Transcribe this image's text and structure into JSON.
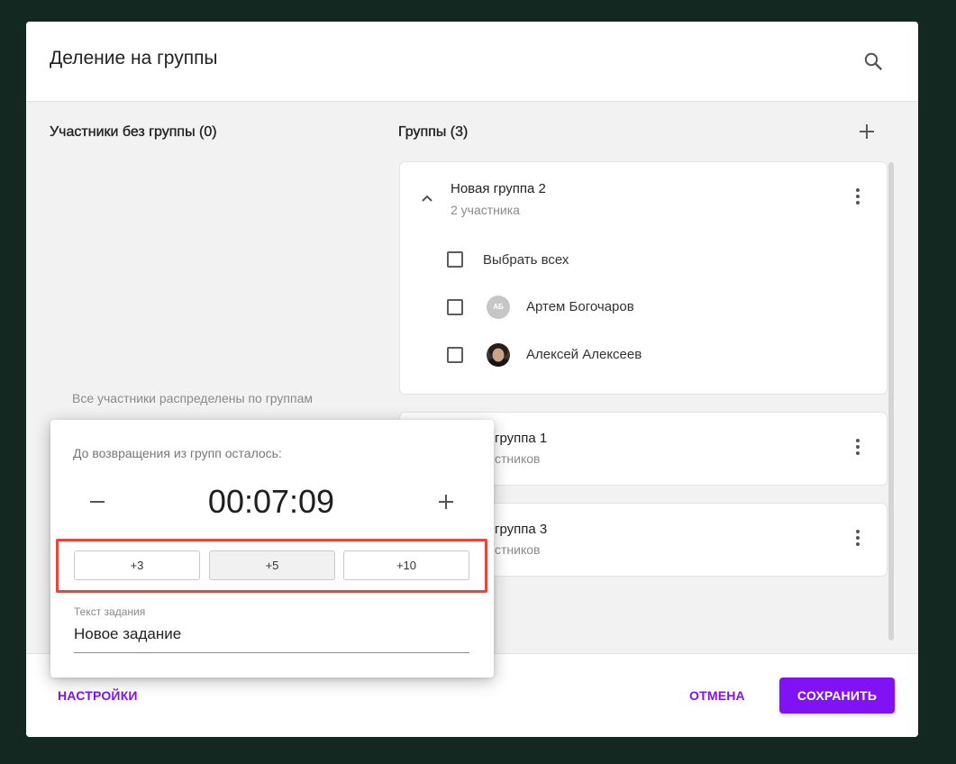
{
  "dialog": {
    "title": "Деление на группы"
  },
  "unassigned": {
    "heading": "Участники без группы (0)",
    "empty_text": "Все участники распределены по группам"
  },
  "groups": {
    "heading": "Группы (3)",
    "items": [
      {
        "title": "Новая группа 2",
        "subtitle": "2 участника",
        "expanded": true,
        "select_all_label": "Выбрать всех",
        "select_all_checked": false,
        "members": [
          {
            "name": "Артем Богочаров",
            "initials": "АБ",
            "checked": false
          },
          {
            "name": "Алексей Алексеев",
            "checked": false
          }
        ]
      },
      {
        "title": "группа 1",
        "subtitle": "стников",
        "expanded": false
      },
      {
        "title": "группа 3",
        "subtitle": "стников",
        "expanded": false
      }
    ]
  },
  "timer_popover": {
    "label": "До возвращения из групп осталось:",
    "time": "00:07:09",
    "quick_add": [
      "+3",
      "+5",
      "+10"
    ],
    "task_label": "Текст задания",
    "task_value": "Новое задание"
  },
  "footer": {
    "settings": "НАСТРОЙКИ",
    "cancel": "ОТМЕНА",
    "save": "СОХРАНИТЬ"
  },
  "icons": {
    "search": "search-icon",
    "add_group": "plus-icon",
    "collapse_group": "chevron-up-icon",
    "group_menu": "kebab-menu-icon",
    "time_decrease": "minus-icon",
    "time_increase": "plus-icon",
    "member_photo": "user-photo-avatar"
  },
  "colors": {
    "page_background": "#132820",
    "panel": "#f2f2f2",
    "accent": "#8012f5",
    "highlight": "#e8443a"
  }
}
